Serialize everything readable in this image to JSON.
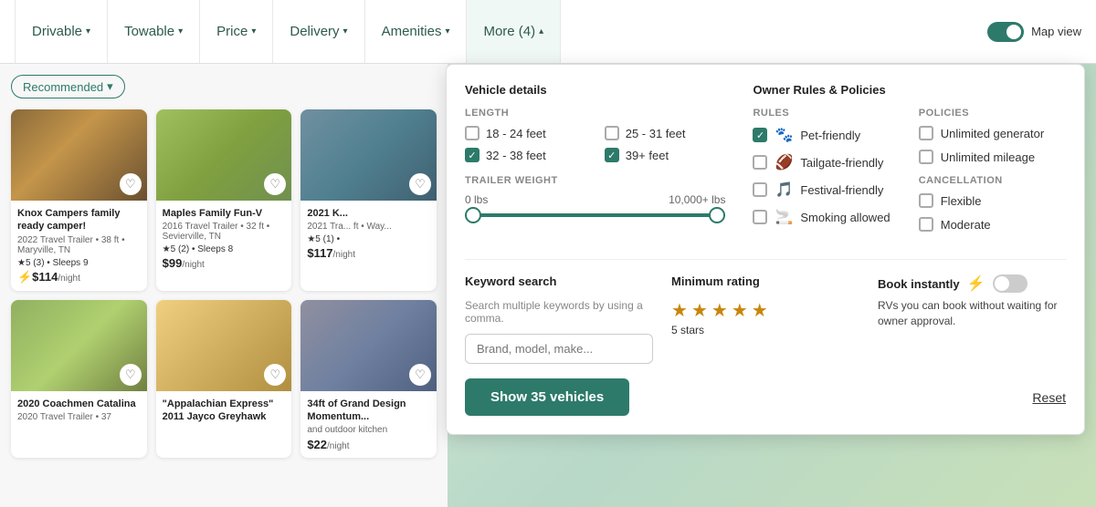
{
  "nav": {
    "items": [
      {
        "label": "Drivable",
        "id": "drivable"
      },
      {
        "label": "Towable",
        "id": "towable"
      },
      {
        "label": "Price",
        "id": "price"
      },
      {
        "label": "Delivery",
        "id": "delivery"
      },
      {
        "label": "Amenities",
        "id": "amenities"
      },
      {
        "label": "More (4)",
        "id": "more",
        "active": true
      }
    ],
    "map_view": "Map view"
  },
  "filter_bar": {
    "recommended": "Recommended"
  },
  "cards": [
    {
      "title": "Knox Campers family ready camper!",
      "sub": "2022 Travel Trailer • 38 ft • Maryville, TN",
      "rating": "★5 (3) • Sleeps 9",
      "price": "⚡$114",
      "price_unit": "/night",
      "img_class": "img1"
    },
    {
      "title": "Maples Family Fun-V",
      "sub": "2016 Travel Trailer • 32 ft • Sevierville, TN",
      "rating": "★5 (2) • Sleeps 8",
      "price": "$99",
      "price_unit": "/night",
      "img_class": "img2"
    },
    {
      "title": "2021 K...",
      "sub": "2021 Tra... ft • Way...",
      "rating": "★5 (1) •",
      "price": "$117",
      "price_unit": "/night",
      "img_class": "img3"
    },
    {
      "title": "2020 Coachmen Catalina",
      "sub": "2020 Travel Trailer • 37",
      "rating": "",
      "price": "",
      "price_unit": "",
      "img_class": "img4"
    },
    {
      "title": "\"Appalachian Express\" 2011 Jayco Greyhawk",
      "sub": "",
      "rating": "",
      "price": "",
      "price_unit": "",
      "img_class": "img5"
    },
    {
      "title": "34ft of Grand Design Momentum...",
      "sub": "and outdoor kitchen",
      "rating": "",
      "price": "$22",
      "price_unit": "/night",
      "img_class": "img6"
    }
  ],
  "panel": {
    "vehicle_details": "Vehicle details",
    "length_label": "LENGTH",
    "lengths": [
      {
        "label": "18 - 24 feet",
        "checked": false
      },
      {
        "label": "25 - 31 feet",
        "checked": false
      },
      {
        "label": "32 - 38 feet",
        "checked": true
      },
      {
        "label": "39+ feet",
        "checked": true
      }
    ],
    "trailer_weight_label": "TRAILER WEIGHT",
    "slider_min": "0 lbs",
    "slider_max": "10,000+ lbs",
    "owner_rules": "Owner Rules & Policies",
    "rules_label": "RULES",
    "policies_label": "POLICIES",
    "cancellation_label": "CANCELLATION",
    "rules": [
      {
        "label": "Pet-friendly",
        "checked": true,
        "icon": "🐾"
      },
      {
        "label": "Tailgate-friendly",
        "checked": false,
        "icon": "🏈"
      },
      {
        "label": "Festival-friendly",
        "checked": false,
        "icon": "🎵"
      },
      {
        "label": "Smoking allowed",
        "checked": false,
        "icon": "🚬"
      }
    ],
    "policies": [
      {
        "label": "Unlimited generator",
        "checked": false
      },
      {
        "label": "Unlimited mileage",
        "checked": false
      }
    ],
    "cancellation": [
      {
        "label": "Flexible",
        "checked": false
      },
      {
        "label": "Moderate",
        "checked": false
      }
    ],
    "keyword_search_title": "Keyword search",
    "keyword_search_sub": "Search multiple keywords by using a comma.",
    "keyword_placeholder": "Brand, model, make...",
    "min_rating_title": "Minimum rating",
    "stars_count": 5,
    "stars_label": "5 stars",
    "book_instantly_title": "Book instantly",
    "book_instantly_icon": "⚡",
    "book_instantly_desc": "RVs you can book without waiting for owner approval.",
    "show_btn": "Show 35 vehicles",
    "reset_btn": "Reset"
  }
}
